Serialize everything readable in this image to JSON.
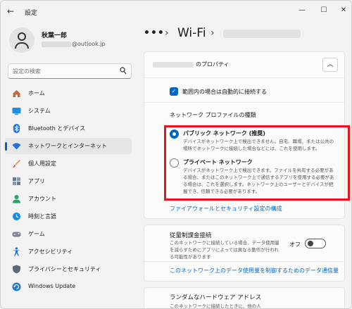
{
  "window": {
    "title": "設定",
    "minimize_glyph": "—",
    "maximize_glyph": "☐",
    "close_glyph": "✕",
    "back_glyph": "←"
  },
  "user": {
    "name": "秋葉一郎",
    "email_suffix": "@outlook.jp"
  },
  "search": {
    "placeholder": "設定の検索"
  },
  "nav": {
    "items": [
      {
        "label": "ホーム",
        "icon": "home-icon"
      },
      {
        "label": "システム",
        "icon": "system-icon"
      },
      {
        "label": "Bluetooth とデバイス",
        "icon": "bluetooth-icon"
      },
      {
        "label": "ネットワークとインターネット",
        "icon": "wifi-icon",
        "selected": true
      },
      {
        "label": "個人用設定",
        "icon": "brush-icon"
      },
      {
        "label": "アプリ",
        "icon": "apps-icon"
      },
      {
        "label": "アカウント",
        "icon": "account-icon"
      },
      {
        "label": "時刻と言語",
        "icon": "globe-clock-icon"
      },
      {
        "label": "ゲーム",
        "icon": "gamepad-icon"
      },
      {
        "label": "アクセシビリティ",
        "icon": "accessibility-icon"
      },
      {
        "label": "プライバシーとセキュリティ",
        "icon": "shield-icon"
      },
      {
        "label": "Windows Update",
        "icon": "update-icon"
      }
    ]
  },
  "breadcrumb": {
    "dots": "•••",
    "separator": "›",
    "current": "Wi-Fi"
  },
  "properties": {
    "header_suffix": "のプロパティ",
    "collapse_glyph": "︿",
    "auto_connect": {
      "label": "範囲内の場合は自動的に接続する",
      "checked": true
    },
    "profile_type_title": "ネットワーク プロファイルの種類",
    "options": [
      {
        "title": "パブリック ネットワーク (推奨)",
        "description": "デバイスがネットワーク上で検出できません。自宅、職場、または公共の場所でネットワークに接続した場合などには、これを使用します。",
        "selected": true
      },
      {
        "title": "プライベート ネットワーク",
        "description": "デバイスがネットワーク上で検出できます。ファイルを共有する必要がある場合、またはこのネットワーク上で通信するアプリを使用する必要がある場合は、これを選択します。ネットワーク上のユーザーとデバイスが把握でき、信頼できる必要があります。",
        "selected": false
      }
    ],
    "firewall_link": "ファイアウォールとセキュリティ設定の構成"
  },
  "metered": {
    "title": "従量制課金接続",
    "description": "このネットワークに接続している場合、データ使用量を減らすためにアプリによっては異なる動作が行われる可能性があります",
    "toggle_label": "オフ",
    "toggle_on": false,
    "link": "このネットワーク上のデータ使用量を制御するためのデータ通信量"
  },
  "random_hw": {
    "title": "ランダムなハードウェア アドレス",
    "description": "このネットワークに接続したときに、他の人"
  },
  "colors": {
    "accent": "#0067c0",
    "highlight_border": "#e4161c"
  }
}
